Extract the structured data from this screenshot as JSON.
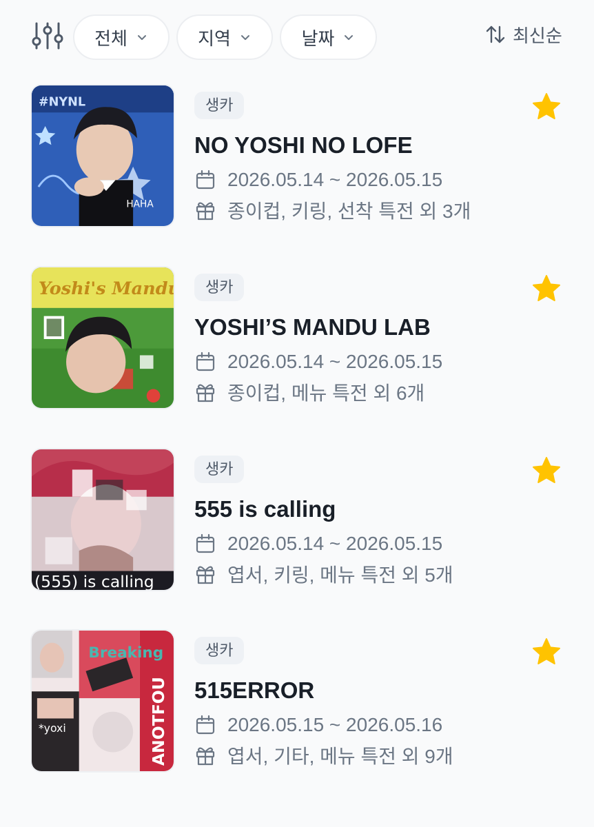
{
  "filters": {
    "all_label": "전체",
    "region_label": "지역",
    "date_label": "날짜",
    "sort_label": "최신순"
  },
  "colors": {
    "star": "#ffc300",
    "badge_bg": "#eef1f5",
    "meta_text": "#6b7684"
  },
  "events": [
    {
      "badge": "생카",
      "title": "NO YOSHI NO LOFE",
      "date": "2026.05.14 ~ 2026.05.15",
      "benefits": "종이컵, 키링, 선착 특전 외 3개",
      "favorited": true,
      "thumbnail": "blue-collage-portrait"
    },
    {
      "badge": "생카",
      "title": "YOSHI’S MANDU LAB",
      "date": "2026.05.14 ~ 2026.05.15",
      "benefits": "종이컵, 메뉴 특전 외 6개",
      "favorited": true,
      "thumbnail": "green-collage-portrait",
      "thumbnail_text": "Yoshi's Mandu Lab"
    },
    {
      "badge": "생카",
      "title": "555 is calling",
      "date": "2026.05.14 ~ 2026.05.15",
      "benefits": "엽서, 키링, 메뉴 특전 외 5개",
      "favorited": true,
      "thumbnail": "pink-glitch-portrait",
      "thumbnail_text": "(555) is calling"
    },
    {
      "badge": "생카",
      "title": "515ERROR",
      "date": "2026.05.15 ~ 2026.05.16",
      "benefits": "엽서, 기타, 메뉴 특전 외 9개",
      "favorited": true,
      "thumbnail": "red-poster-collage",
      "thumbnail_text": "ANOTFOU"
    }
  ]
}
